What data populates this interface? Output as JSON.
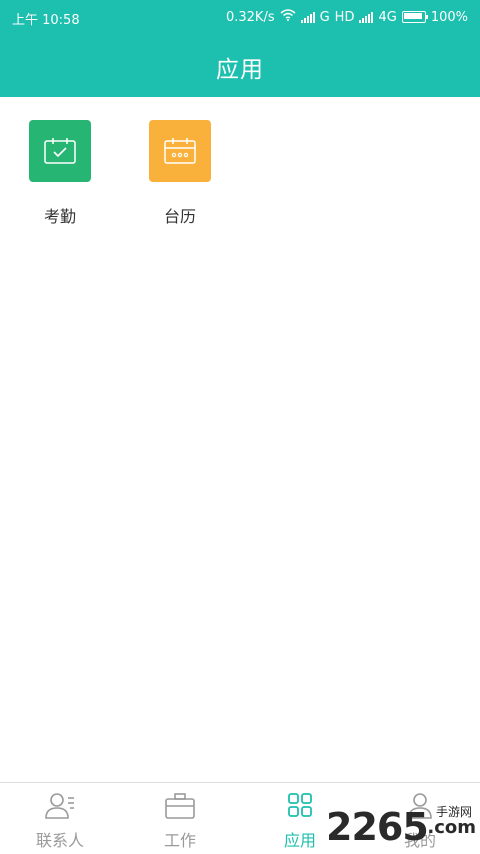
{
  "status_bar": {
    "time": "上午 10:58",
    "net_speed": "0.32K/s",
    "network_g": "G",
    "network_hd": "HD",
    "network_4g": "4G",
    "battery": "100%"
  },
  "header": {
    "title": "应用"
  },
  "apps": [
    {
      "label": "考勤",
      "icon": "calendar-check-icon",
      "color": "#27b574"
    },
    {
      "label": "台历",
      "icon": "calendar-icon",
      "color": "#f9b13b"
    }
  ],
  "tabs": [
    {
      "label": "联系人",
      "icon": "contacts-icon",
      "active": false
    },
    {
      "label": "工作",
      "icon": "briefcase-icon",
      "active": false
    },
    {
      "label": "应用",
      "icon": "apps-grid-icon",
      "active": true
    },
    {
      "label": "我的",
      "icon": "person-icon",
      "active": false
    }
  ],
  "watermark": {
    "number": "2265",
    "subtitle": "手游网",
    "domain": ".com"
  },
  "colors": {
    "accent": "#1dbfae",
    "inactive": "#9a9a9a"
  }
}
